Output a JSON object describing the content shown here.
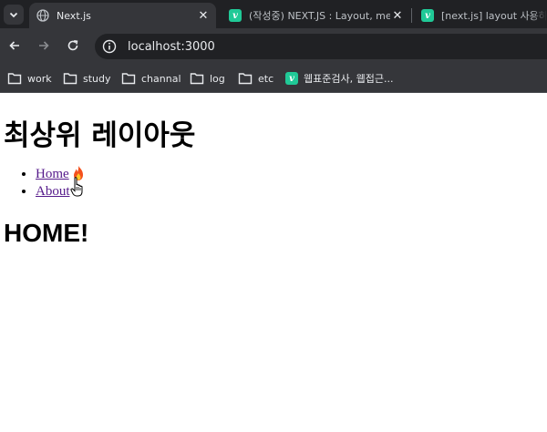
{
  "browser": {
    "tabs": [
      {
        "title": "Next.js",
        "icon": "globe-icon",
        "active": true
      },
      {
        "title": "(작성중) NEXT.JS : Layout, met",
        "icon": "velog-icon",
        "active": false
      },
      {
        "title": "[next.js] layout 사용하기",
        "icon": "velog-icon",
        "active": false
      }
    ],
    "close_glyph": "✕",
    "tab_search_icon": "chevron-down-icon",
    "url": "localhost:3000",
    "bookmarks": [
      {
        "label": "work",
        "icon": "folder-icon"
      },
      {
        "label": "study",
        "icon": "folder-icon"
      },
      {
        "label": "channal",
        "icon": "folder-icon"
      },
      {
        "label": "log",
        "icon": "folder-icon"
      },
      {
        "label": "etc",
        "icon": "folder-icon"
      },
      {
        "label": "웹표준검사, 웹접근...",
        "icon": "velog-icon"
      }
    ],
    "velog_glyph": "v"
  },
  "page": {
    "title": "최상위 레이아웃",
    "nav": [
      {
        "label": "Home"
      },
      {
        "label": "About"
      }
    ],
    "heading": "HOME!"
  },
  "colors": {
    "chrome_dark": "#202124",
    "chrome_toolbar": "#35363a",
    "velog_green": "#20c997",
    "visited_link": "#551a8b"
  }
}
